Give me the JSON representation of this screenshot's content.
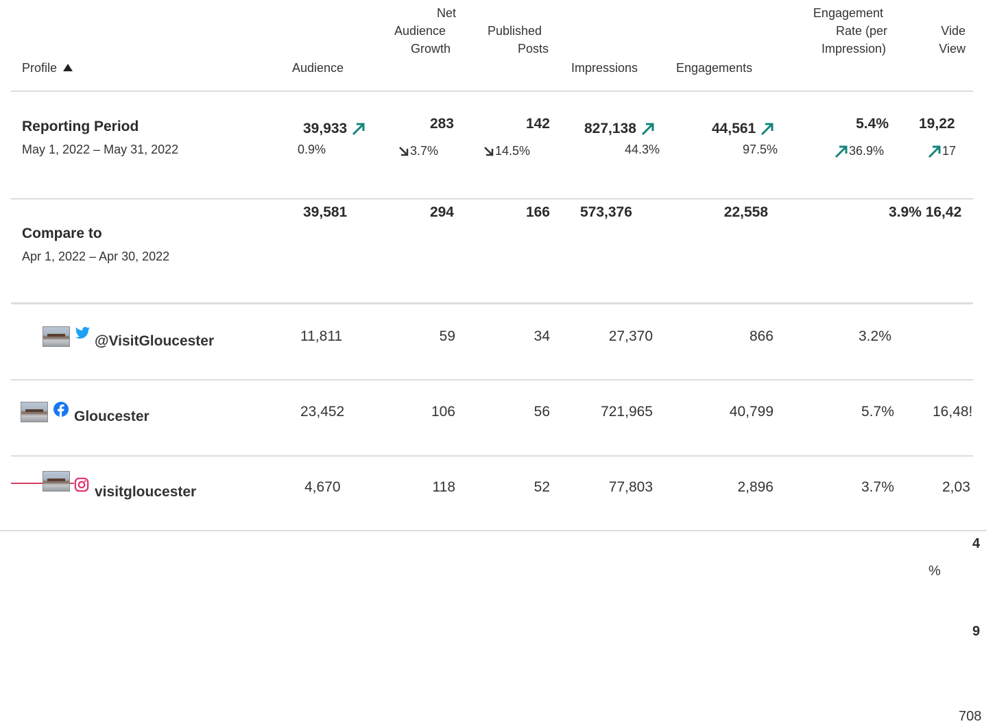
{
  "headers": {
    "profile": "Profile",
    "audience": "Audience",
    "net_audience_growth": [
      "Net",
      "Audience",
      "Growth"
    ],
    "published_posts": [
      "Published",
      "Posts"
    ],
    "impressions": "Impressions",
    "engagements": "Engagements",
    "engagement_rate": [
      "Engagement",
      "Rate (per",
      "Impression)"
    ],
    "video_views": [
      "Vide",
      "View"
    ]
  },
  "reporting": {
    "label": "Reporting Period",
    "dates": "May 1, 2022 – May 31, 2022",
    "audience": "39,933",
    "audience_change": "0.9%",
    "net_growth": "283",
    "net_growth_change": "3.7%",
    "posts": "142",
    "posts_change": "14.5%",
    "impressions": "827,138",
    "impressions_change": "44.3%",
    "engagements": "44,561",
    "engagements_change": "97.5%",
    "rate": "5.4%",
    "rate_change": "36.9%",
    "video": "19,22",
    "video_change": "17"
  },
  "compare": {
    "label": "Compare to",
    "dates": "Apr 1, 2022 – Apr 30, 2022",
    "audience": "39,581",
    "net_growth": "294",
    "posts": "166",
    "impressions": "573,376",
    "engagements": "22,558",
    "rate_video": "3.9% 16,42"
  },
  "profiles": [
    {
      "name": "@VisitGloucester",
      "network": "twitter-icon",
      "audience": "11,811",
      "net_growth": "59",
      "posts": "34",
      "impressions": "27,370",
      "engagements": "866",
      "rate": "3.2%",
      "video": ""
    },
    {
      "name": "Gloucester",
      "network": "facebook-icon",
      "audience": "23,452",
      "net_growth": "106",
      "posts": "56",
      "impressions": "721,965",
      "engagements": "40,799",
      "rate": "5.7%",
      "video": "16,48!"
    },
    {
      "name": "visitgloucester",
      "network": "instagram-icon",
      "audience": "4,670",
      "net_growth": "118",
      "posts": "52",
      "impressions": "77,803",
      "engagements": "2,896",
      "rate": "3.7%",
      "video": "2,03"
    }
  ],
  "overflow": {
    "a": "4",
    "b": "%",
    "c": "9",
    "d": "708"
  },
  "colors": {
    "accent": "#14857a",
    "twitter": "#1da1f2",
    "facebook": "#1877f2",
    "instagram": "#e1306c"
  }
}
